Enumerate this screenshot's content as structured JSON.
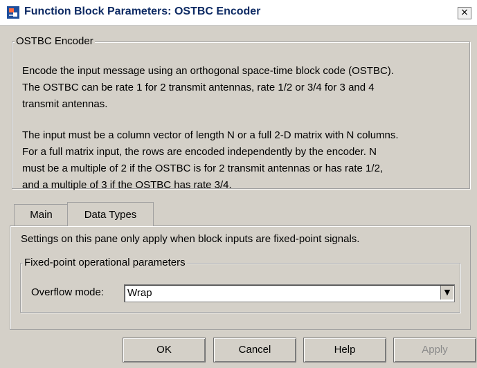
{
  "window": {
    "title": "Function Block Parameters: OSTBC Encoder",
    "close_label": "×"
  },
  "description": {
    "legend": "OSTBC Encoder",
    "paragraph1_lines": [
      "Encode the input message using an orthogonal space-time block code (OSTBC).",
      "The OSTBC can be rate 1 for 2 transmit antennas, rate 1/2 or 3/4 for 3 and 4",
      "transmit antennas."
    ],
    "paragraph2_lines": [
      "The input must be a column vector of length N or a full 2-D matrix with N columns.",
      "For a full matrix input, the rows are encoded independently by the encoder. N",
      "must be a multiple of 2 if the OSTBC is for 2 transmit antennas or has rate 1/2,",
      "and a multiple of 3 if the OSTBC has rate 3/4."
    ]
  },
  "tabs": [
    {
      "label": "Main",
      "active": false
    },
    {
      "label": "Data Types",
      "active": true
    }
  ],
  "pane": {
    "note": "Settings on this pane only apply when block inputs are fixed-point signals.",
    "group_legend": "Fixed-point operational parameters",
    "overflow_label": "Overflow mode:",
    "overflow_value": "Wrap"
  },
  "buttons": {
    "ok": "OK",
    "cancel": "Cancel",
    "help": "Help",
    "apply": "Apply"
  }
}
